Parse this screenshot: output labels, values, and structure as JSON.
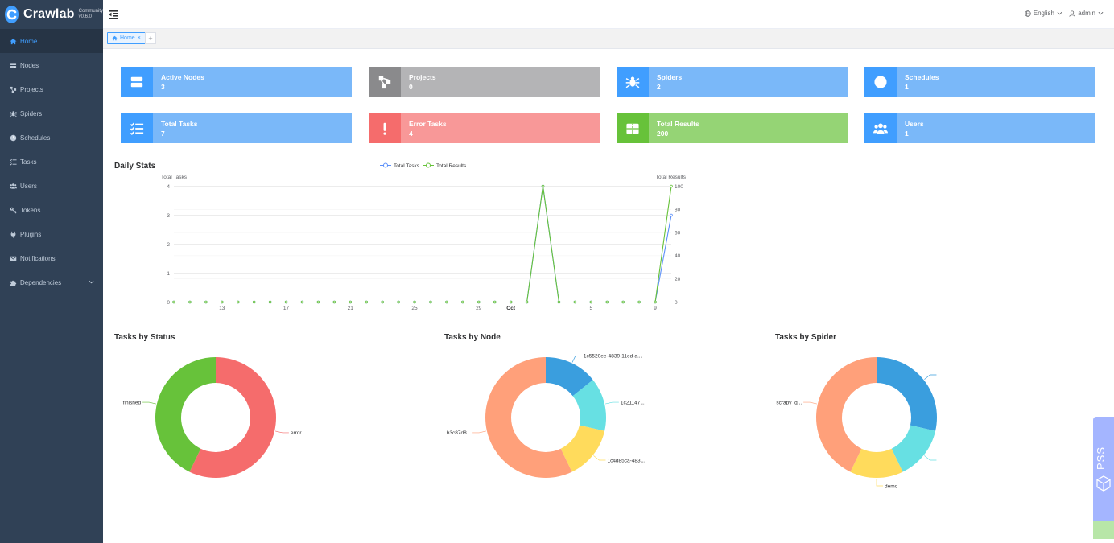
{
  "app": {
    "name": "Crawlab",
    "edition": "Community",
    "version": "v0.6.0"
  },
  "sidebar": {
    "items": [
      {
        "label": "Home",
        "icon": "home-icon",
        "active": true
      },
      {
        "label": "Nodes",
        "icon": "server-icon"
      },
      {
        "label": "Projects",
        "icon": "project-icon"
      },
      {
        "label": "Spiders",
        "icon": "spider-icon"
      },
      {
        "label": "Schedules",
        "icon": "clock-icon"
      },
      {
        "label": "Tasks",
        "icon": "tasks-icon"
      },
      {
        "label": "Users",
        "icon": "users-icon"
      },
      {
        "label": "Tokens",
        "icon": "key-icon"
      },
      {
        "label": "Plugins",
        "icon": "plug-icon"
      },
      {
        "label": "Notifications",
        "icon": "envelope-icon"
      },
      {
        "label": "Dependencies",
        "icon": "puzzle-icon"
      }
    ]
  },
  "header": {
    "language": "English",
    "user": "admin"
  },
  "tabs": [
    {
      "label": "Home"
    }
  ],
  "metrics": [
    {
      "label": "Active Nodes",
      "value": "3",
      "icon": "server-icon",
      "color": "#7ab8f9"
    },
    {
      "label": "Projects",
      "value": "0",
      "icon": "project-icon",
      "color": "#b4b4b6"
    },
    {
      "label": "Spiders",
      "value": "2",
      "icon": "spider-icon",
      "color": "#7ab8f9"
    },
    {
      "label": "Schedules",
      "value": "1",
      "icon": "clock-icon",
      "color": "#7ab8f9"
    },
    {
      "label": "Total Tasks",
      "value": "7",
      "icon": "tasks-icon",
      "color": "#7ab8f9"
    },
    {
      "label": "Error Tasks",
      "value": "4",
      "icon": "exclamation-icon",
      "color": "#f89898"
    },
    {
      "label": "Total Results",
      "value": "200",
      "icon": "table-icon",
      "color": "#95d475"
    },
    {
      "label": "Users",
      "value": "1",
      "icon": "users-icon",
      "color": "#7ab8f9"
    }
  ],
  "daily_stats": {
    "title": "Daily Stats",
    "legend": [
      "Total Tasks",
      "Total Results"
    ],
    "left_axis_label": "Total Tasks",
    "right_axis_label": "Total Results"
  },
  "chart_data": [
    {
      "type": "line",
      "title": "Daily Stats",
      "x_tick_labels": [
        "13",
        "17",
        "21",
        "25",
        "29",
        "Oct",
        "5",
        "9"
      ],
      "x_label_positions": [
        3,
        7,
        11,
        15,
        19,
        21,
        26,
        30
      ],
      "yleft_label": "Total Tasks",
      "yright_label": "Total Results",
      "yleft_ticks": [
        0,
        1,
        2,
        3,
        4
      ],
      "yright_ticks": [
        0,
        20,
        40,
        60,
        80,
        100
      ],
      "ylim_left": [
        0,
        4
      ],
      "ylim_right": [
        0,
        100
      ],
      "colors": {
        "Total Tasks": "#5b8ff9",
        "Total Results": "#67c23a"
      },
      "series": [
        {
          "name": "Total Tasks",
          "axis": "left",
          "values": [
            0,
            0,
            0,
            0,
            0,
            0,
            0,
            0,
            0,
            0,
            0,
            0,
            0,
            0,
            0,
            0,
            0,
            0,
            0,
            0,
            0,
            0,
            0,
            4,
            0,
            0,
            0,
            0,
            0,
            0,
            0,
            3
          ]
        },
        {
          "name": "Total Results",
          "axis": "right",
          "values": [
            0,
            0,
            0,
            0,
            0,
            0,
            0,
            0,
            0,
            0,
            0,
            0,
            0,
            0,
            0,
            0,
            0,
            0,
            0,
            0,
            0,
            0,
            0,
            100,
            0,
            0,
            0,
            0,
            0,
            0,
            0,
            100
          ]
        }
      ],
      "grid": true,
      "legend_position": "top-center"
    },
    {
      "type": "pie",
      "title": "Tasks by Status",
      "donut": true,
      "slices": [
        {
          "label": "error",
          "value": 4,
          "color": "#f56c6c"
        },
        {
          "label": "finished",
          "value": 3,
          "color": "#67c23a"
        }
      ]
    },
    {
      "type": "pie",
      "title": "Tasks by Node",
      "donut": true,
      "slices": [
        {
          "label": "1c5520ee-4839-11ed-a...",
          "value": 1,
          "color": "#3a9ede"
        },
        {
          "label": "1c21147...",
          "value": 1,
          "color": "#67e0e3"
        },
        {
          "label": "1c4d85ca-483...",
          "value": 1,
          "color": "#ffdb5c"
        },
        {
          "label": "b3c87d8...",
          "value": 4,
          "color": "#ffa07a"
        }
      ]
    },
    {
      "type": "pie",
      "title": "Tasks by Spider",
      "donut": true,
      "slices": [
        {
          "label": "",
          "value": 2,
          "color": "#3a9ede"
        },
        {
          "label": "",
          "value": 1,
          "color": "#67e0e3"
        },
        {
          "label": "demo",
          "value": 1,
          "color": "#ffdb5c"
        },
        {
          "label": "scrapy_q...",
          "value": 3,
          "color": "#ffa07a"
        }
      ]
    }
  ],
  "sections": {
    "status_title": "Tasks by Status",
    "node_title": "Tasks by Node",
    "spider_title": "Tasks by Spider"
  },
  "widget": {
    "label": "PSS"
  }
}
